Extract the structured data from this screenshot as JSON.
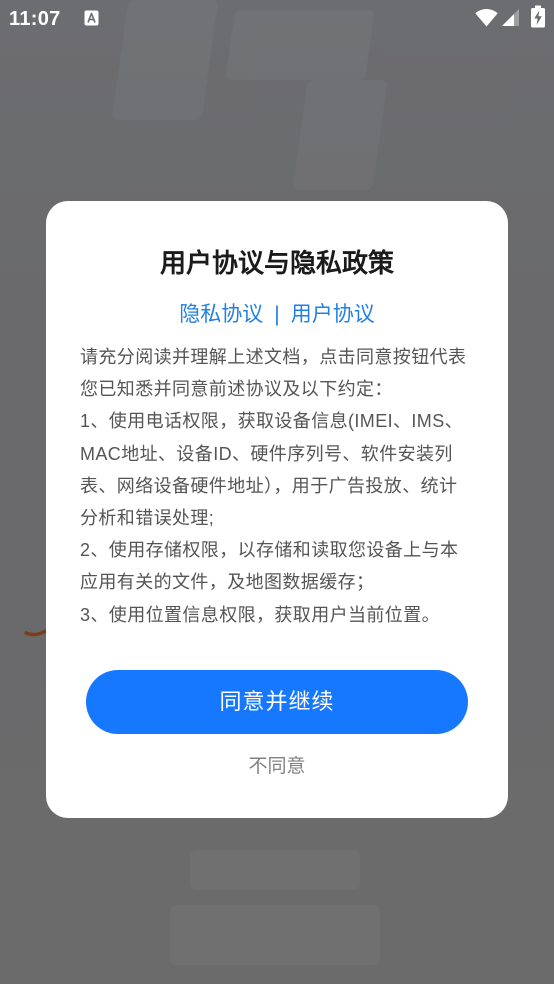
{
  "status_bar": {
    "time": "11:07",
    "icons": {
      "left": [
        "keyboard-a-icon"
      ],
      "right": [
        "wifi-icon",
        "signal-icon",
        "battery-charging-icon"
      ]
    }
  },
  "dialog": {
    "title": "用户协议与隐私政策",
    "links": {
      "privacy_policy": "隐私协议",
      "separator": "|",
      "user_agreement": "用户协议"
    },
    "body_lines": [
      "请充分阅读并理解上述文档，点击同意按钮代表",
      "您已知悉并同意前述协议及以下约定：",
      "1、使用电话权限，获取设备信息(IMEI、IMS、",
      "MAC地址、设备ID、硬件序列号、软件安装列",
      "表、网络设备硬件地址），用于广告投放、统计",
      "分析和错误处理;",
      "2、使用存储权限，以存储和读取您设备上与本",
      "应用有关的文件，及地图数据缓存；",
      "3、使用位置信息权限，获取用户当前位置。"
    ],
    "agree_button": "同意并继续",
    "disagree_button": "不同意"
  },
  "colors": {
    "backdrop": "#6b6b6b",
    "dialog_background": "#ffffff",
    "title_text": "#1b1b1b",
    "body_text": "#555555",
    "link": "#1f80e5",
    "primary_button": "#1677ff",
    "primary_button_text": "#ffffff",
    "secondary_text": "#808080"
  }
}
